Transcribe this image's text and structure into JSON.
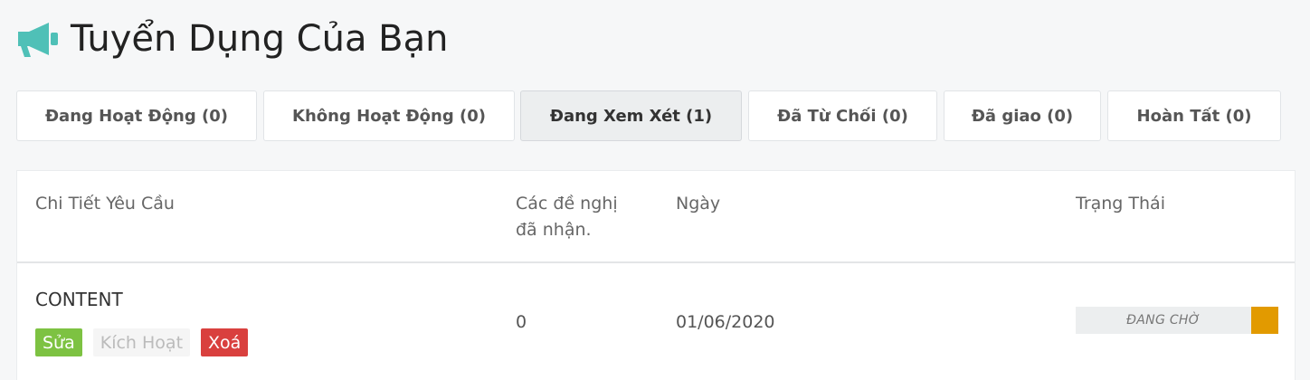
{
  "header": {
    "title": "Tuyển Dụng Của Bạn",
    "icon": "megaphone-icon",
    "icon_color": "#4fc0b7"
  },
  "tabs": [
    {
      "label": "Đang Hoạt Động (0)",
      "active": false
    },
    {
      "label": "Không Hoạt Động (0)",
      "active": false
    },
    {
      "label": "Đang Xem Xét (1)",
      "active": true
    },
    {
      "label": "Đã Từ Chối (0)",
      "active": false
    },
    {
      "label": "Đã giao (0)",
      "active": false
    },
    {
      "label": "Hoàn Tất (0)",
      "active": false
    }
  ],
  "table": {
    "columns": {
      "details": "Chi Tiết Yêu Cầu",
      "offers_line1": "Các đề nghị",
      "offers_line2": "đã nhận.",
      "date": "Ngày",
      "status": "Trạng Thái"
    },
    "rows": [
      {
        "title": "CONTENT",
        "actions": {
          "edit": "Sửa",
          "activate": "Kích Hoạt",
          "delete": "Xoá"
        },
        "offers": "0",
        "date": "01/06/2020",
        "status": "ĐANG CHỜ",
        "status_color": "#e29a00"
      }
    ]
  }
}
